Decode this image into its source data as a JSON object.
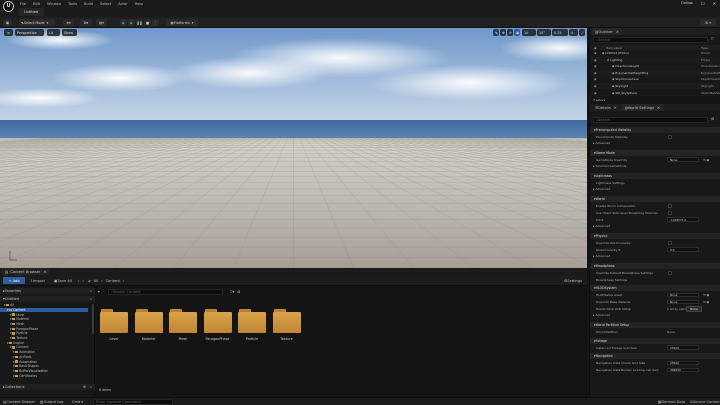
{
  "app": {
    "menus": [
      "File",
      "Edit",
      "Window",
      "Tools",
      "Build",
      "Select",
      "Actor",
      "Help"
    ],
    "document_tab": "Untitled",
    "user_label": "Online",
    "window_controls": [
      "—",
      "☐",
      "✕"
    ]
  },
  "toolbar": {
    "mode": "Select Mode",
    "platforms": "Platforms"
  },
  "viewport": {
    "perspective": "Perspective",
    "lit": "Lit",
    "show": "Show",
    "snap_grid": "10",
    "snap_rotate": "10°",
    "snap_scale": "0.25",
    "cam_speed": "4"
  },
  "content_browser": {
    "tab": "Content Browser",
    "add_label": "+ Add",
    "import_label": "Import",
    "save_all_label": "Save All",
    "path": [
      "All",
      "Content"
    ],
    "settings_label": "Settings",
    "favorites_label": "Favorites",
    "collections_label": "Collections",
    "search_placeholder": "Search Content",
    "tree_root": "Untitled",
    "tree": [
      {
        "label": "All",
        "depth": 0
      },
      {
        "label": "Content",
        "depth": 1
      },
      {
        "label": "Level",
        "depth": 2
      },
      {
        "label": "Material",
        "depth": 2
      },
      {
        "label": "Mesh",
        "depth": 2
      },
      {
        "label": "ParagonPhase",
        "depth": 2
      },
      {
        "label": "Particle",
        "depth": 2
      },
      {
        "label": "Texture",
        "depth": 2
      },
      {
        "label": "Engine",
        "depth": 1
      },
      {
        "label": "Content",
        "depth": 2
      },
      {
        "label": "Animation",
        "depth": 3
      },
      {
        "label": "ArtTools",
        "depth": 3
      },
      {
        "label": "Automation",
        "depth": 3
      },
      {
        "label": "BasicShapes",
        "depth": 3
      },
      {
        "label": "BufferVisualization",
        "depth": 3
      },
      {
        "label": "Certificates",
        "depth": 3
      }
    ],
    "folders": [
      "Level",
      "Material",
      "Mesh",
      "ParagonPhase",
      "Particle",
      "Texture"
    ],
    "item_count": "6 items"
  },
  "status": {
    "content_drawer": "Content Drawer",
    "output_log": "Output Log",
    "cmd": "Cmd",
    "console_placeholder": "Enter Console Command",
    "derived_data": "Derived Data",
    "source_control": "Source Control"
  },
  "outliner": {
    "title": "Outliner",
    "search_placeholder": "Search",
    "col_item": "Item Label",
    "col_type": "Type",
    "rows": [
      {
        "label": "Untitled (Editor)",
        "type": "World",
        "depth": 0
      },
      {
        "label": "Lighting",
        "type": "Folder",
        "depth": 1
      },
      {
        "label": "DirectionalLight",
        "type": "DirectionalLi",
        "depth": 2
      },
      {
        "label": "ExponentialHeightFog",
        "type": "ExponentialH",
        "depth": 2
      },
      {
        "label": "SkyAtmosphere",
        "type": "SkyAtmosphere",
        "depth": 2
      },
      {
        "label": "SkyLight",
        "type": "SkyLight",
        "depth": 2
      },
      {
        "label": "SM_SkySphere",
        "type": "StaticMeshAc",
        "depth": 2
      }
    ],
    "actor_count": "7 actors"
  },
  "details": {
    "tab_details": "Details",
    "tab_world": "World Settings",
    "search_placeholder": "Search",
    "items": [
      {
        "kind": "section",
        "label": "Precomputed Visibility"
      },
      {
        "kind": "prop",
        "label": "Precompute Visibility",
        "ctrl": "check"
      },
      {
        "kind": "adv",
        "label": "Advanced"
      },
      {
        "kind": "section",
        "label": "Game Mode"
      },
      {
        "kind": "prop",
        "label": "GameMode Override",
        "ctrl": "select",
        "value": "None"
      },
      {
        "kind": "adv",
        "label": "Selected GameMode"
      },
      {
        "kind": "section",
        "label": "Lightmass"
      },
      {
        "kind": "prop",
        "label": "Lightmass Settings",
        "ctrl": "none"
      },
      {
        "kind": "adv",
        "label": "Advanced"
      },
      {
        "kind": "section",
        "label": "World"
      },
      {
        "kind": "prop",
        "label": "Enable World Composition",
        "ctrl": "check"
      },
      {
        "kind": "prop",
        "label": "Use Client Side Level Streaming Volumes",
        "ctrl": "check"
      },
      {
        "kind": "prop",
        "label": "Kill Z",
        "ctrl": "num",
        "value": "-1048575.0"
      },
      {
        "kind": "adv",
        "label": "Advanced"
      },
      {
        "kind": "section",
        "label": "Physics"
      },
      {
        "kind": "prop",
        "label": "Override World Gravity",
        "ctrl": "check"
      },
      {
        "kind": "prop",
        "label": "Global Gravity Z",
        "ctrl": "num",
        "value": "0.0"
      },
      {
        "kind": "adv",
        "label": "Advanced"
      },
      {
        "kind": "section",
        "label": "Broadphase"
      },
      {
        "kind": "prop",
        "label": "Override Default Broadphase Settings",
        "ctrl": "check"
      },
      {
        "kind": "prop",
        "label": "Broadphase Settings",
        "ctrl": "none"
      },
      {
        "kind": "section",
        "label": "HLODSystem"
      },
      {
        "kind": "prop",
        "label": "HLODSetup Asset",
        "ctrl": "select",
        "value": "None"
      },
      {
        "kind": "prop",
        "label": "Override Base Material",
        "ctrl": "select",
        "value": "None"
      },
      {
        "kind": "prop",
        "label": "Hierarchical LOD Setup",
        "ctrl": "text",
        "value": "1 Array elements"
      },
      {
        "kind": "adv",
        "label": "Advanced"
      },
      {
        "kind": "section",
        "label": "World Partition Setup"
      },
      {
        "kind": "prop",
        "label": "World Partition",
        "ctrl": "text",
        "value": "None"
      },
      {
        "kind": "section",
        "label": "Foliage"
      },
      {
        "kind": "prop",
        "label": "Instanced Foliage Grid Size",
        "ctrl": "num",
        "value": "25600"
      },
      {
        "kind": "section",
        "label": "Navigation"
      },
      {
        "kind": "prop",
        "label": "Navigation Data Chunk Grid Size",
        "ctrl": "num",
        "value": "25600"
      },
      {
        "kind": "prop",
        "label": "Navigation Data Builder Loading Cell Size",
        "ctrl": "num",
        "value": "409600"
      }
    ],
    "tooltip": "None"
  },
  "colors": {
    "accent": "#0070e0",
    "folder": "#d29b45",
    "panel": "#181818",
    "sky_top": "#7aa2d0",
    "floor": "#bdb6ad"
  }
}
